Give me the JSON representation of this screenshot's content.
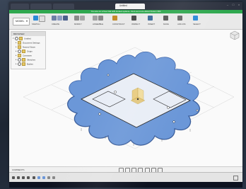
{
  "app": {
    "tab_titles": [
      "",
      "Untitled",
      "",
      ""
    ],
    "banner_text": "You are on a free trial with limited options. Find out more about Fusion 360"
  },
  "toolbar": {
    "workspace": "MODEL",
    "groups": [
      {
        "label": "SKETCH",
        "color": "#2b8ad8"
      },
      {
        "label": "CREATE",
        "color": "#6d7fa6"
      },
      {
        "label": "MODIFY",
        "color": "#8b8b8b"
      },
      {
        "label": "ASSEMBLE",
        "color": "#a0a0a0"
      },
      {
        "label": "CONSTRUCT",
        "color": "#c48b2a"
      },
      {
        "label": "INSPECT",
        "color": "#4a4a4a"
      },
      {
        "label": "INSERT",
        "color": "#3c6a99"
      },
      {
        "label": "MAKE",
        "color": "#555555"
      },
      {
        "label": "ADD-INS",
        "color": "#666666"
      },
      {
        "label": "SELECT",
        "color": "#2b8ad8"
      }
    ]
  },
  "browser": {
    "title": "BROWSER",
    "nodes": [
      {
        "label": "Untitled"
      },
      {
        "label": "Document Settings"
      },
      {
        "label": "Named Views"
      },
      {
        "label": "Origin"
      },
      {
        "label": "Canvases"
      },
      {
        "label": "Sketches"
      },
      {
        "label": "Bodies"
      }
    ]
  },
  "colors": {
    "sketch_fill": "#6b97d8",
    "sketch_stroke": "#3a62a8",
    "origin_plane": "#e8c66a",
    "grid_line": "#c8c8c8"
  },
  "status": {
    "comments_label": "COMMENTS"
  },
  "taskbar": {
    "text": ""
  }
}
